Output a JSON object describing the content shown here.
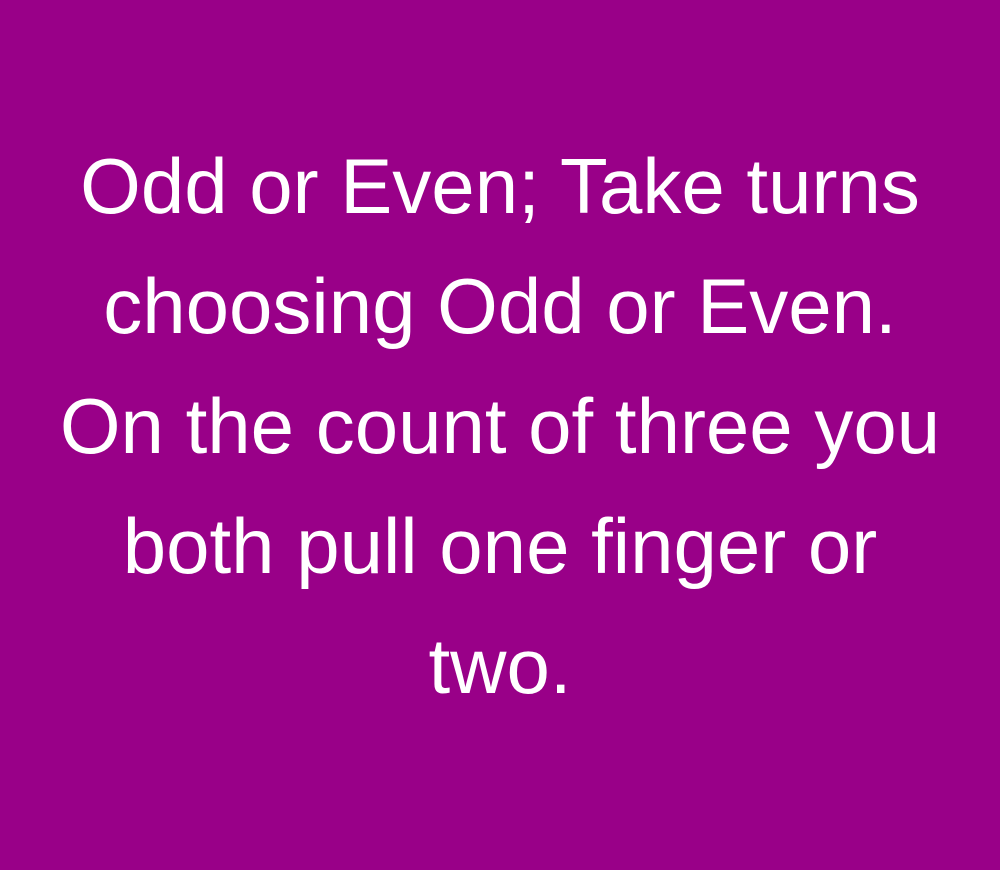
{
  "background_color": "#990088",
  "text_color": "#ffffff",
  "lines": [
    "Odd or Even; Take turns",
    "choosing Odd or Even.",
    "On the count of three you",
    "both pull one finger or",
    "two."
  ]
}
